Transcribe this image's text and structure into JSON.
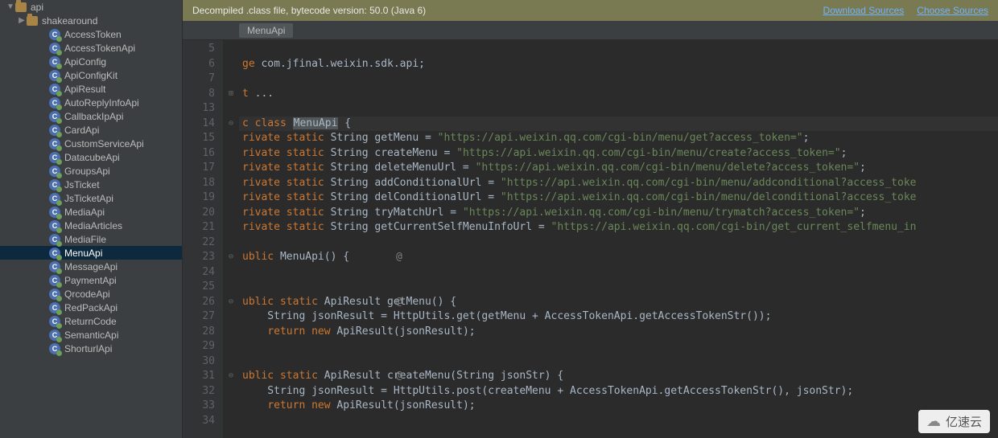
{
  "tree": {
    "root": {
      "name": "api",
      "expanded": true
    },
    "pkg": {
      "name": "shakearound",
      "expanded": false
    },
    "classes": [
      "AccessToken",
      "AccessTokenApi",
      "ApiConfig",
      "ApiConfigKit",
      "ApiResult",
      "AutoReplyInfoApi",
      "CallbackIpApi",
      "CardApi",
      "CustomServiceApi",
      "DatacubeApi",
      "GroupsApi",
      "JsTicket",
      "JsTicketApi",
      "MediaApi",
      "MediaArticles",
      "MediaFile",
      "MenuApi",
      "MessageApi",
      "PaymentApi",
      "QrcodeApi",
      "RedPackApi",
      "ReturnCode",
      "SemanticApi",
      "ShorturlApi"
    ],
    "selected": "MenuApi"
  },
  "banner": {
    "message": "Decompiled .class file, bytecode version: 50.0 (Java 6)",
    "link1": "Download Sources",
    "link2": "Choose Sources"
  },
  "breadcrumb": {
    "item": "MenuApi"
  },
  "line_numbers": [
    5,
    6,
    7,
    8,
    13,
    14,
    15,
    16,
    17,
    18,
    19,
    20,
    21,
    22,
    23,
    24,
    25,
    26,
    27,
    28,
    29,
    30,
    31,
    32,
    33,
    34
  ],
  "fold_marks": {
    "0": "",
    "1": "",
    "2": "",
    "3": "⊞",
    "4": "",
    "5": "⊖",
    "6": "",
    "7": "",
    "8": "",
    "9": "",
    "10": "",
    "11": "",
    "12": "",
    "13": "",
    "14": "⊖",
    "15": "",
    "16": "",
    "17": "⊖",
    "18": "",
    "19": "",
    "20": "",
    "21": "",
    "22": "⊖",
    "23": "",
    "24": "",
    "25": ""
  },
  "annot": {
    "14": "@",
    "17": "@",
    "22": "@"
  },
  "code": {
    "l0": "",
    "l1_a": "ge",
    "l1_b": " com.jfinal.weixin.sdk.api;",
    "l2": "",
    "l3_a": "t",
    "l3_b": " ...",
    "l4": "",
    "l5_a": "c class ",
    "l5_cls": "MenuApi",
    "l5_b": " {",
    "l6_a": "rivate static",
    "l6_b": " String getMenu = ",
    "l6_c": "\"https://api.weixin.qq.com/cgi-bin/menu/get?access_token=\"",
    "l6_d": ";",
    "l7_a": "rivate static",
    "l7_b": " String createMenu = ",
    "l7_c": "\"https://api.weixin.qq.com/cgi-bin/menu/create?access_token=\"",
    "l7_d": ";",
    "l8_a": "rivate static",
    "l8_b": " String deleteMenuUrl = ",
    "l8_c": "\"https://api.weixin.qq.com/cgi-bin/menu/delete?access_token=\"",
    "l8_d": ";",
    "l9_a": "rivate static",
    "l9_b": " String addConditionalUrl = ",
    "l9_c": "\"https://api.weixin.qq.com/cgi-bin/menu/addconditional?access_toke",
    "l10_a": "rivate static",
    "l10_b": " String delConditionalUrl = ",
    "l10_c": "\"https://api.weixin.qq.com/cgi-bin/menu/delconditional?access_toke",
    "l11_a": "rivate static",
    "l11_b": " String tryMatchUrl = ",
    "l11_c": "\"https://api.weixin.qq.com/cgi-bin/menu/trymatch?access_token=\"",
    "l11_d": ";",
    "l12_a": "rivate static",
    "l12_b": " String getCurrentSelfMenuInfoUrl = ",
    "l12_c": "\"https://api.weixin.qq.com/cgi-bin/get_current_selfmenu_in",
    "l13": "",
    "l14_a": "ublic",
    "l14_b": " MenuApi() {",
    "l15": "",
    "l16": "",
    "l17_a": "ublic static",
    "l17_b": " ApiResult getMenu() {",
    "l18": "    String jsonResult = HttpUtils.get(getMenu + AccessTokenApi.getAccessTokenStr());",
    "l19_a": "    ",
    "l19_b": "return new",
    "l19_c": " ApiResult(jsonResult);",
    "l20": "",
    "l21": "",
    "l22_a": "ublic static",
    "l22_b": " ApiResult createMenu(String jsonStr) {",
    "l23": "    String jsonResult = HttpUtils.post(createMenu + AccessTokenApi.getAccessTokenStr(), jsonStr);",
    "l24_a": "    ",
    "l24_b": "return new",
    "l24_c": " ApiResult(jsonResult);",
    "l25": ""
  },
  "watermark": {
    "text": "亿速云"
  }
}
